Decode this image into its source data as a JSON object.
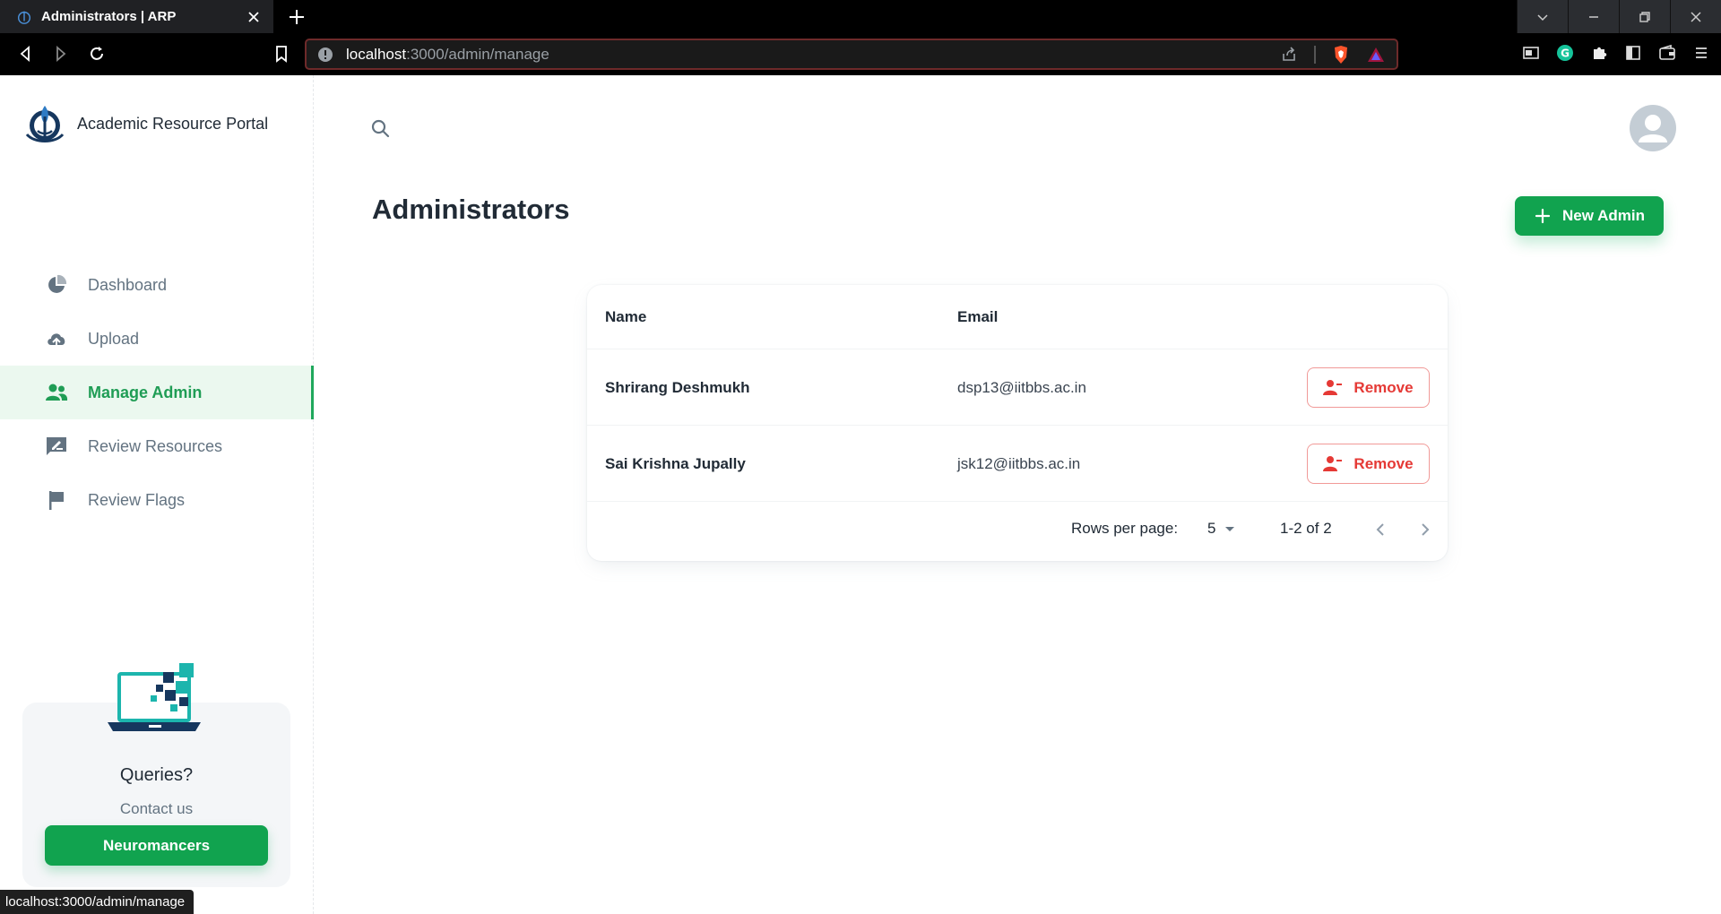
{
  "browser": {
    "tab_title": "Administrators | ARP",
    "url_host": "localhost",
    "url_path": ":3000/admin/manage",
    "status_url": "localhost:3000/admin/manage"
  },
  "sidebar": {
    "brand_name": "Academic Resource Portal",
    "items": [
      {
        "label": "Dashboard",
        "icon": "pie-chart-icon",
        "active": false
      },
      {
        "label": "Upload",
        "icon": "cloud-upload-icon",
        "active": false
      },
      {
        "label": "Manage Admin",
        "icon": "users-icon",
        "active": true
      },
      {
        "label": "Review Resources",
        "icon": "review-edit-icon",
        "active": false
      },
      {
        "label": "Review Flags",
        "icon": "flag-icon",
        "active": false
      }
    ],
    "help": {
      "title": "Queries?",
      "subtitle": "Contact us",
      "button_label": "Neuromancers"
    }
  },
  "main": {
    "title": "Administrators",
    "new_button_label": "New Admin",
    "table": {
      "columns": [
        "Name",
        "Email"
      ],
      "rows": [
        {
          "name": "Shrirang Deshmukh",
          "email": "dsp13@iitbbs.ac.in",
          "action": "Remove"
        },
        {
          "name": "Sai Krishna Jupally",
          "email": "jsk12@iitbbs.ac.in",
          "action": "Remove"
        }
      ],
      "pagination": {
        "rows_per_page_label": "Rows per page:",
        "rows_per_page_value": "5",
        "range": "1-2 of 2"
      }
    }
  },
  "colors": {
    "primary": "#11a34f",
    "danger": "#e53935",
    "text": "#212b36",
    "muted": "#637381"
  }
}
